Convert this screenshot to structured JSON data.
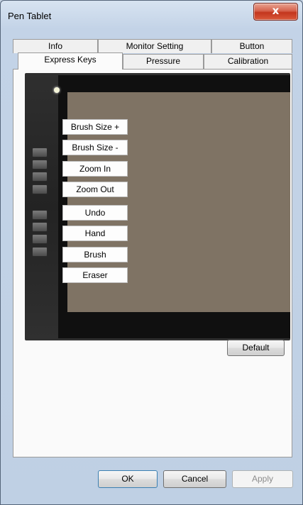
{
  "window": {
    "title": "Pen Tablet",
    "close_glyph": "x"
  },
  "icons": {
    "close": "close-icon"
  },
  "tabs_back_row": [
    {
      "label": "Info"
    },
    {
      "label": "Monitor Setting"
    },
    {
      "label": "Button"
    }
  ],
  "tabs_front_row": [
    {
      "label": "Express Keys",
      "selected": true
    },
    {
      "label": "Pressure"
    },
    {
      "label": "Calibration"
    }
  ],
  "express_keys": [
    {
      "label": "Brush Size +"
    },
    {
      "label": "Brush Size -"
    },
    {
      "label": "Zoom In"
    },
    {
      "label": "Zoom Out"
    },
    {
      "label": "Undo"
    },
    {
      "label": "Hand"
    },
    {
      "label": "Brush"
    },
    {
      "label": "Eraser"
    }
  ],
  "buttons": {
    "default": "Default",
    "ok": "OK",
    "cancel": "Cancel",
    "apply": "Apply"
  },
  "colors": {
    "tablet_body": "#232323",
    "tablet_screen": "#7f7364",
    "close_button": "#c3361e"
  }
}
